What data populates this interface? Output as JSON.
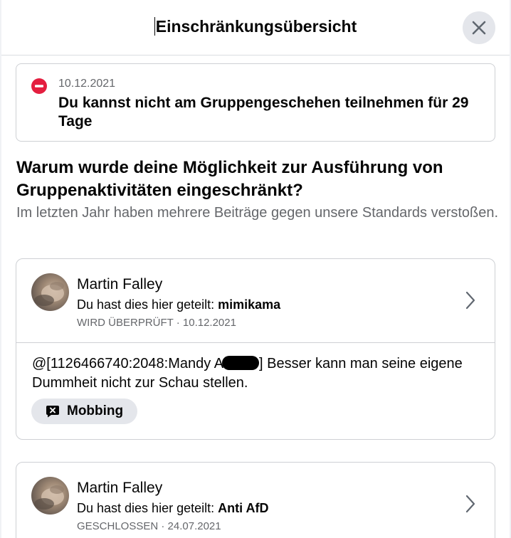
{
  "dialog": {
    "title": "Einschränkungsübersicht",
    "close_icon": "close-icon"
  },
  "notice": {
    "icon": "stop-icon",
    "date": "10.12.2021",
    "text": "Du kannst nicht am Gruppengeschehen teilnehmen für 29 Tage"
  },
  "why": {
    "heading": "Warum wurde deine Möglichkeit zur Ausführung von Gruppenaktivitäten eingeschränkt?",
    "subtext": "Im letzten Jahr haben mehrere Beiträge gegen unsere Standards verstoßen."
  },
  "violations": [
    {
      "name": "Martin Falley",
      "shared_prefix": "Du hast dies hier geteilt:",
      "shared_target": "mimikama",
      "status": "WIRD ÜBERPRÜFT · 10.12.2021",
      "comment_before": "@[1126466740:2048:Mandy A",
      "comment_after": "] Besser kann man seine eigene Dummheit nicht zur Schau stellen.",
      "tag_icon": "speech-bubble-x-icon",
      "tag_label": "Mobbing"
    },
    {
      "name": "Martin Falley",
      "shared_prefix": "Du hast dies hier geteilt:",
      "shared_target": "Anti AfD",
      "status": "GESCHLOSSEN · 24.07.2021"
    }
  ]
}
